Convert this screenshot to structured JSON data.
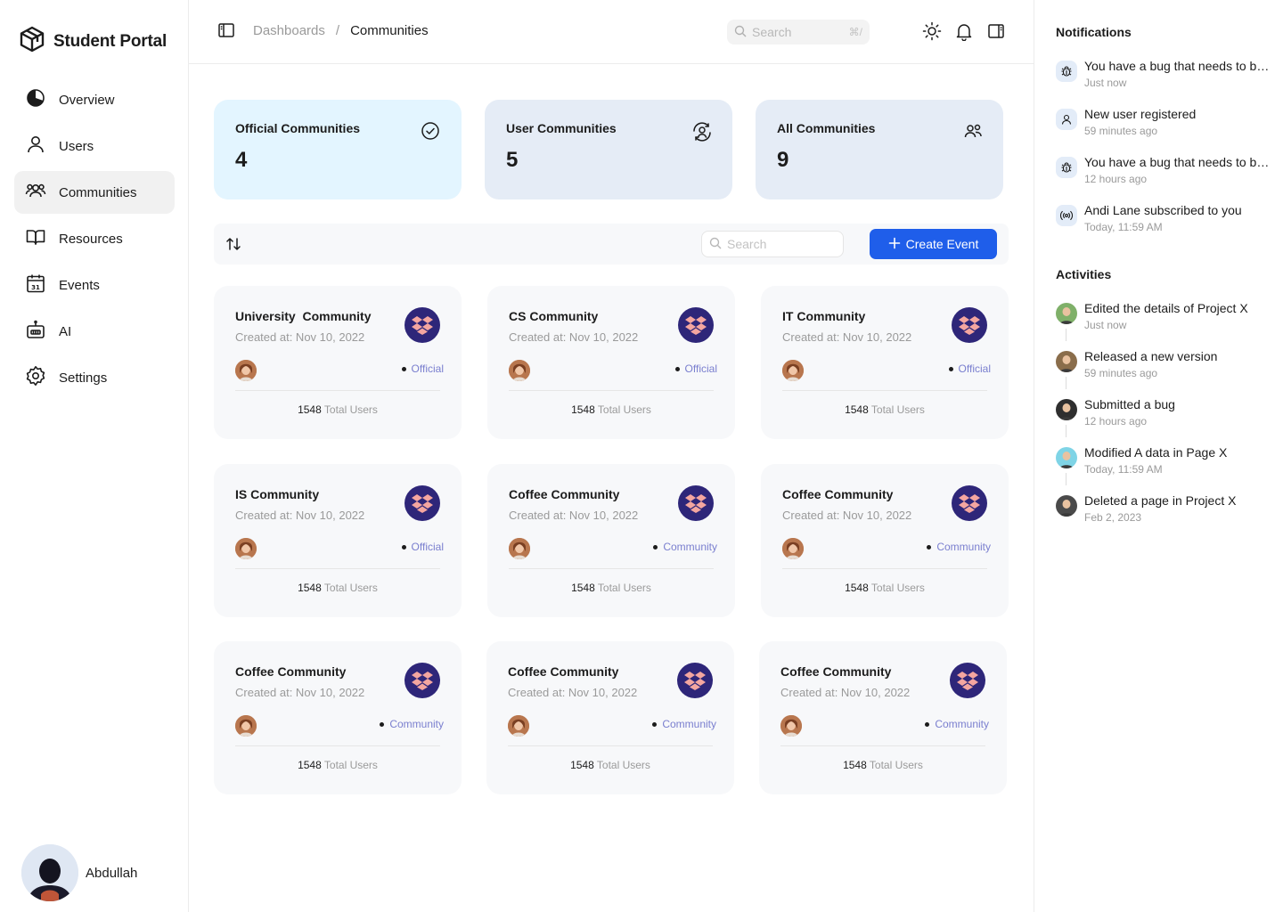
{
  "app": {
    "title": "Student Portal"
  },
  "sidebar": {
    "items": [
      {
        "label": "Overview",
        "icon": "overview-pie-icon"
      },
      {
        "label": "Users",
        "icon": "user-icon"
      },
      {
        "label": "Communities",
        "icon": "users-group-icon",
        "active": true
      },
      {
        "label": "Resources",
        "icon": "book-open-icon"
      },
      {
        "label": "Events",
        "icon": "calendar-icon"
      },
      {
        "label": "AI",
        "icon": "robot-icon"
      },
      {
        "label": "Settings",
        "icon": "gear-icon"
      }
    ],
    "profile": {
      "name": "Abdullah"
    }
  },
  "topbar": {
    "breadcrumb": [
      "Dashboards",
      "/",
      "Communities"
    ],
    "search_placeholder": "Search",
    "search_shortcut": "⌘/"
  },
  "stats": [
    {
      "label": "Official Communities",
      "value": "4",
      "icon": "check-circle-icon",
      "bg": "#e3f5ff"
    },
    {
      "label": "User Communities",
      "value": "5",
      "icon": "user-sync-icon",
      "bg": "#e5ecf6"
    },
    {
      "label": "All Communities",
      "value": "9",
      "icon": "users-group-icon",
      "bg": "#e5ecf6"
    }
  ],
  "toolbar": {
    "search_placeholder": "Search",
    "create_label": "Create Event"
  },
  "cards": [
    {
      "title": "University  Community",
      "date": "Created at: Nov 10, 2022",
      "badge": "Official",
      "users": "1548",
      "users_label": "Total Users"
    },
    {
      "title": "CS Community",
      "date": "Created at: Nov 10, 2022",
      "badge": "Official",
      "users": "1548",
      "users_label": "Total Users"
    },
    {
      "title": "IT Community",
      "date": "Created at: Nov 10, 2022",
      "badge": "Official",
      "users": "1548",
      "users_label": "Total Users"
    },
    {
      "title": "IS Community",
      "date": "Created at: Nov 10, 2022",
      "badge": "Official",
      "users": "1548",
      "users_label": "Total Users"
    },
    {
      "title": "Coffee Community",
      "date": "Created at: Nov 10, 2022",
      "badge": "Community",
      "users": "1548",
      "users_label": "Total Users"
    },
    {
      "title": "Coffee Community",
      "date": "Created at: Nov 10, 2022",
      "badge": "Community",
      "users": "1548",
      "users_label": "Total Users"
    },
    {
      "title": "Coffee Community",
      "date": "Created at: Nov 10, 2022",
      "badge": "Community",
      "users": "1548",
      "users_label": "Total Users"
    },
    {
      "title": "Coffee Community",
      "date": "Created at: Nov 10, 2022",
      "badge": "Community",
      "users": "1548",
      "users_label": "Total Users"
    },
    {
      "title": "Coffee Community",
      "date": "Created at: Nov 10, 2022",
      "badge": "Community",
      "users": "1548",
      "users_label": "Total Users"
    }
  ],
  "notifications": {
    "title": "Notifications",
    "items": [
      {
        "text": "You have a bug that needs to be fixed",
        "time": "Just now",
        "icon": "bug-icon"
      },
      {
        "text": "New user registered",
        "time": "59 minutes ago",
        "icon": "user-icon"
      },
      {
        "text": "You have a bug that needs to be fixed",
        "time": "12 hours ago",
        "icon": "bug-icon"
      },
      {
        "text": "Andi Lane subscribed to you",
        "time": "Today, 11:59 AM",
        "icon": "broadcast-icon"
      }
    ]
  },
  "activities": {
    "title": "Activities",
    "items": [
      {
        "text": "Edited the details of Project X",
        "time": "Just now",
        "avatar_color": "#7fb069"
      },
      {
        "text": "Released a new version",
        "time": "59 minutes ago",
        "avatar_color": "#8a6d4b"
      },
      {
        "text": "Submitted a bug",
        "time": "12 hours ago",
        "avatar_color": "#2f2f2f"
      },
      {
        "text": "Modified A data in Page X",
        "time": "Today, 11:59 AM",
        "avatar_color": "#7fd4e6"
      },
      {
        "text": "Deleted a page in Project X",
        "time": "Feb 2, 2023",
        "avatar_color": "#4a4a4a"
      }
    ]
  },
  "colors": {
    "accent": "#1f5eea",
    "badge_text": "#7a7fcf",
    "logo_bg": "#2e2679",
    "logo_fg": "#f4a6a0"
  }
}
